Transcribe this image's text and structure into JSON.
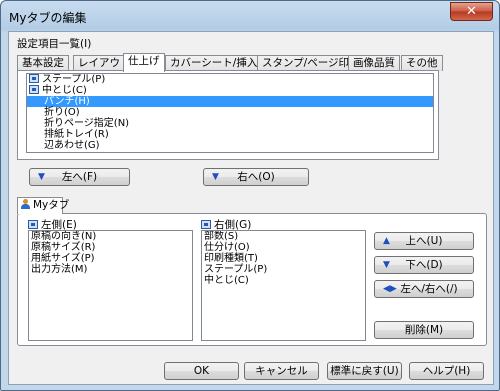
{
  "window": {
    "title": "Myタブの編集",
    "close": "✕"
  },
  "settings_label": "設定項目一覧(I)",
  "tabs": [
    "基本設定",
    "レイアウト",
    "仕上げ",
    "カバーシート/挿入紙",
    "スタンプ/ページ印字",
    "画像品質",
    "その他"
  ],
  "active_tab": "仕上げ",
  "items": [
    {
      "label": "ステープル(P)",
      "icon": true,
      "selected": false
    },
    {
      "label": "中とじ(C)",
      "icon": true,
      "selected": false
    },
    {
      "label": "パンチ(H)",
      "icon": false,
      "selected": true
    },
    {
      "label": "折り(O)",
      "icon": false,
      "selected": false
    },
    {
      "label": "折りページ指定(N)",
      "icon": false,
      "selected": false
    },
    {
      "label": "排紙トレイ(R)",
      "icon": false,
      "selected": false
    },
    {
      "label": "辺あわせ(G)",
      "icon": false,
      "selected": false
    }
  ],
  "buttons": {
    "to_left": "左へ(F)",
    "to_right": "右へ(O)",
    "up": "上へ(U)",
    "down": "下へ(D)",
    "swap": "左へ/右へ(/)",
    "delete": "削除(M)",
    "ok": "OK",
    "cancel": "キャンセル",
    "reset": "標準に戻す(U)",
    "help": "ヘルプ(H)"
  },
  "mytab_label": "Myタブ",
  "left_side": {
    "label": "左側(E)",
    "items": [
      "原稿の向き(N)",
      "原稿サイズ(R)",
      "用紙サイズ(P)",
      "出力方法(M)"
    ]
  },
  "right_side": {
    "label": "右側(G)",
    "items": [
      "部数(S)",
      "仕分け(O)",
      "印刷種類(T)",
      "ステープル(P)",
      "中とじ(C)"
    ]
  }
}
